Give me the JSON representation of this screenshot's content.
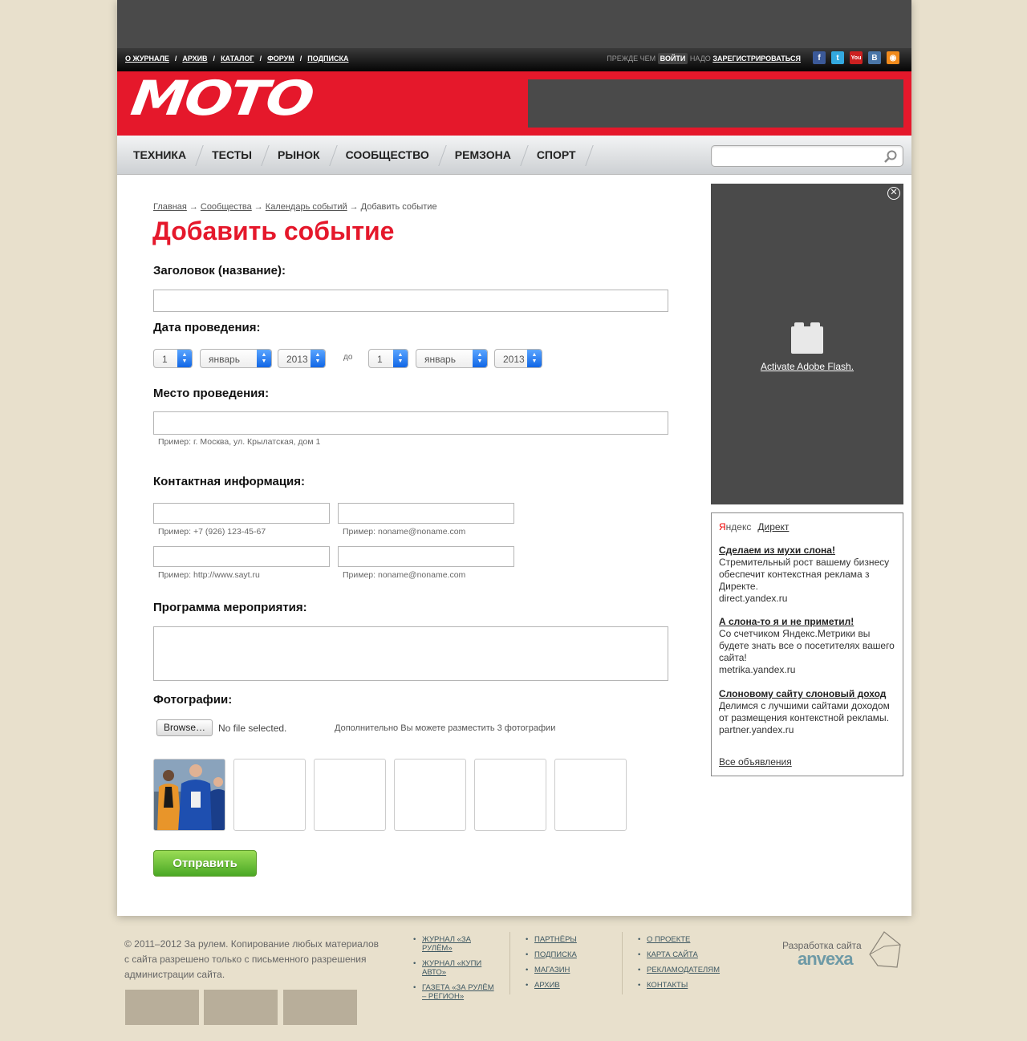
{
  "topnav": {
    "links": [
      "О ЖУРНАЛЕ",
      "АРХИВ",
      "КАТАЛОГ",
      "ФОРУМ",
      "ПОДПИСКА"
    ],
    "separator": "/",
    "login_prefix": "ПРЕЖДЕ ЧЕМ",
    "login_button": "ВОЙТИ",
    "login_mid": "НАДО",
    "register_link": "ЗАРЕГИСТРИРОВАТЬСЯ"
  },
  "social": [
    {
      "name": "facebook-icon",
      "glyph": "f",
      "color": "#3b5998"
    },
    {
      "name": "twitter-icon",
      "glyph": "t",
      "color": "#33a9e0"
    },
    {
      "name": "youtube-icon",
      "glyph": "You",
      "color": "#cc2020"
    },
    {
      "name": "vkontakte-icon",
      "glyph": "B",
      "color": "#4a76a8"
    },
    {
      "name": "rss-icon",
      "glyph": "◉",
      "color": "#f08a1c"
    }
  ],
  "logo": {
    "text": "MOTO"
  },
  "mainnav": {
    "items": [
      "ТЕХНИКА",
      "ТЕСТЫ",
      "РЫНОК",
      "СООБЩЕСТВО",
      "РЕМЗОНА",
      "СПОРТ"
    ]
  },
  "search": {
    "placeholder": ""
  },
  "breadcrumb": {
    "items": [
      "Главная",
      "Сообщества",
      "Календарь событий"
    ],
    "current": "Добавить событие",
    "arrow": "→"
  },
  "form": {
    "title": "Добавить событие",
    "name_label": "Заголовок (название):",
    "date_label": "Дата проведения:",
    "date_from": {
      "day": "1",
      "month": "январь",
      "year": "2013"
    },
    "date_to_label": "до",
    "date_to": {
      "day": "1",
      "month": "январь",
      "year": "2013"
    },
    "place_label": "Место проведения:",
    "place_hint": "Пример: г. Москва, ул. Крылатская, дом 1",
    "contact_label": "Контактная информация:",
    "phone_hint": "Пример: +7 (926) 123-45-67",
    "email_hint": "Пример: noname@noname.com",
    "site_hint": "Пример: http://www.sayt.ru",
    "email2_hint": "Пример: noname@noname.com",
    "program_label": "Программа мероприятия:",
    "photos_label": "Фотографии:",
    "browse_button": "Browse…",
    "no_file": "No file selected.",
    "photos_hint": "Дополнительно Вы можете разместить 3 фотографии",
    "submit": "Отправить"
  },
  "flash": {
    "link": "Activate Adobe Flash."
  },
  "direct": {
    "brand_ya": "Я",
    "brand_rest": "ндекс",
    "direct_link": "Директ",
    "ads": [
      {
        "title": "Сделаем из мухи слона!",
        "text": "Стремительный рост вашему бизнесу обеспечит контекстная реклама з Директе.",
        "url": "direct.yandex.ru"
      },
      {
        "title": "А слона-то я и не приметил!",
        "text": "Со счетчиком Яндекс.Метрики вы будете знать все о посетителях вашего сайта!",
        "url": "metrika.yandex.ru"
      },
      {
        "title": "Слоновому сайту слоновый доход",
        "text": "Делимся с лучшими сайтами доходом от размещения контекстной рекламы.",
        "url": "partner.yandex.ru"
      }
    ],
    "all_ads": "Все объявления"
  },
  "footer": {
    "copyright": "© 2011–2012 За рулем. Копирование любых материалов с сайта разрешено только с письменного разрешения администрации сайта.",
    "col1": [
      "ЖУРНАЛ «ЗА РУЛЁМ»",
      "ЖУРНАЛ «КУПИ АВТО»",
      "ГАЗЕТА «ЗА РУЛЁМ – РЕГИОН»"
    ],
    "col2": [
      "ПАРТНЁРЫ",
      "ПОДПИСКА",
      "МАГАЗИН",
      "АРХИВ"
    ],
    "col3": [
      "О ПРОЕКТЕ",
      "КАРТА САЙТА",
      "РЕКЛАМОДАТЕЛЯМ",
      "КОНТАКТЫ"
    ],
    "dev_label": "Разработка сайта",
    "dev_brand": "anvexa"
  }
}
